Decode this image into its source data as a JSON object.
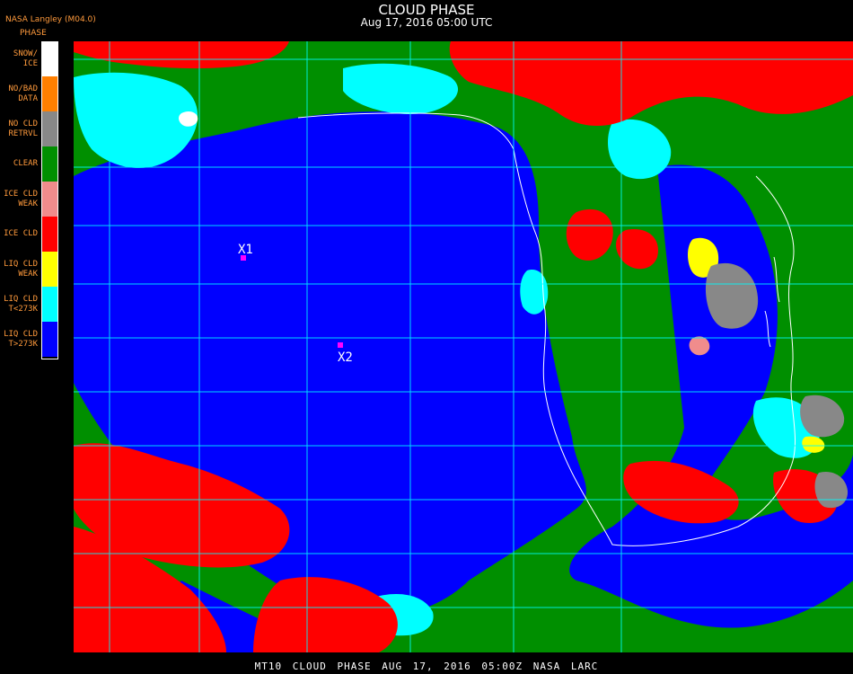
{
  "header": {
    "title": "CLOUD PHASE",
    "date": "Aug 17, 2016 05:00 UTC",
    "producer": "NASA Langley (M04.0)"
  },
  "legend": {
    "title": "PHASE",
    "items": [
      {
        "lines": [
          "SNOW/",
          "ICE"
        ],
        "color": "#ffffff"
      },
      {
        "lines": [
          "NO/BAD",
          "DATA"
        ],
        "color": "#ff7f00"
      },
      {
        "lines": [
          "NO CLD",
          "RETRVL"
        ],
        "color": "#888888"
      },
      {
        "lines": [
          "CLEAR"
        ],
        "color": "#008f00"
      },
      {
        "lines": [
          "ICE CLD",
          "WEAK"
        ],
        "color": "#f08c8c"
      },
      {
        "lines": [
          "ICE CLD"
        ],
        "color": "#ff0000"
      },
      {
        "lines": [
          "LIQ CLD",
          "WEAK"
        ],
        "color": "#ffff00"
      },
      {
        "lines": [
          "LIQ CLD",
          "T<273K"
        ],
        "color": "#00ffff"
      },
      {
        "lines": [
          "LIQ CLD",
          "T>273K"
        ],
        "color": "#0000ff"
      }
    ]
  },
  "markers": [
    {
      "label": "X1",
      "color": "#ff00ff"
    },
    {
      "label": "X2",
      "color": "#ff00ff"
    }
  ],
  "footer": "MT10  CLOUD PHASE  AUG 17, 2016 05:00Z  NASA LARC"
}
